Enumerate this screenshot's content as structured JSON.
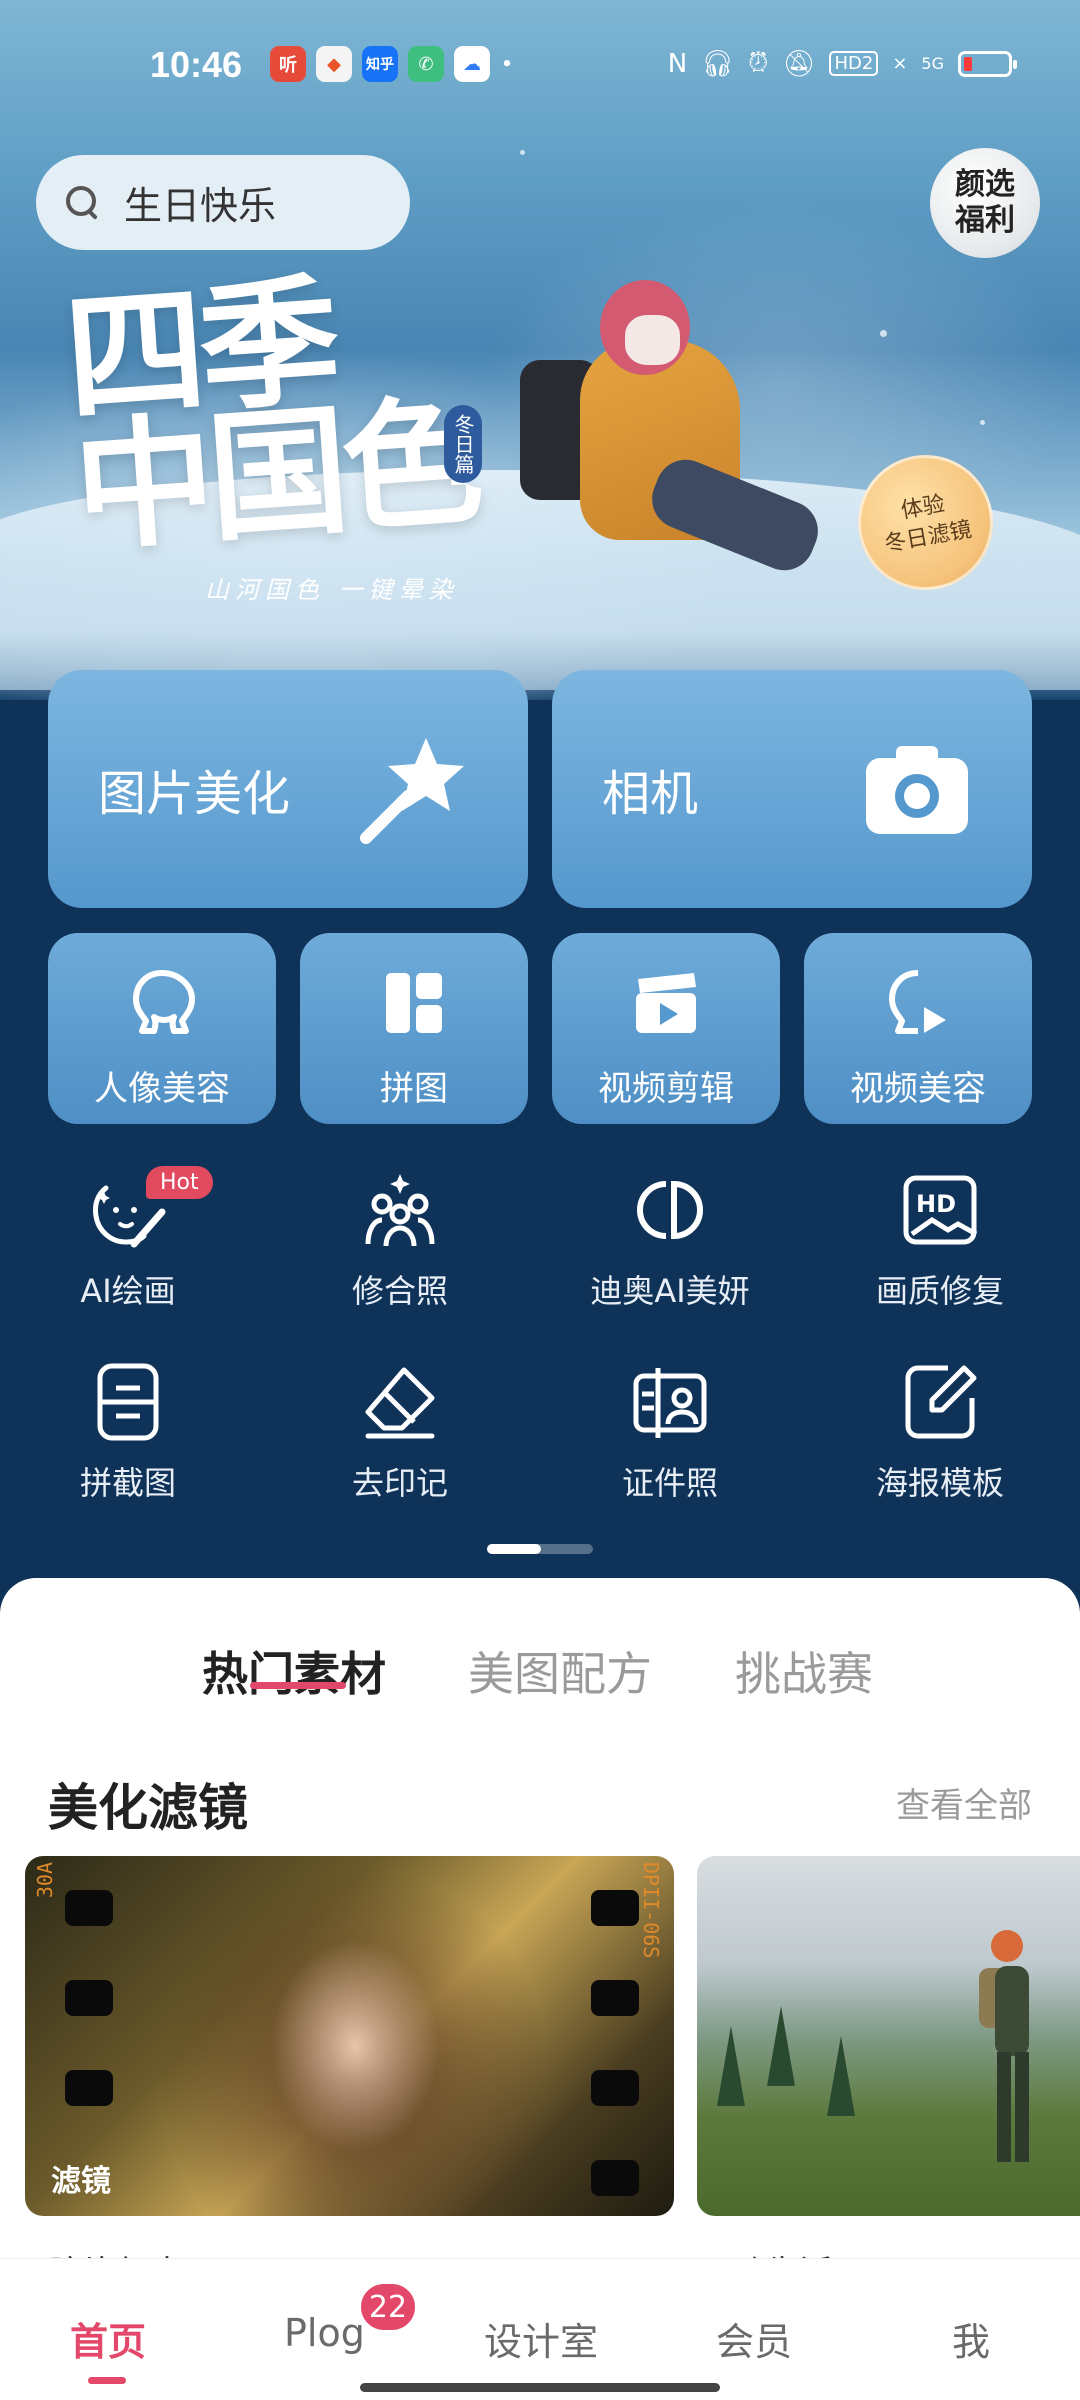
{
  "status_bar": {
    "time": "10:46",
    "app_icons": [
      {
        "name": "ting-app-icon",
        "text": "听",
        "color": "#e84a3a"
      },
      {
        "name": "game-app-icon",
        "text": "",
        "color": "#f0f0f0"
      },
      {
        "name": "zhihu-app-icon",
        "text": "知乎",
        "color": "#1772f6"
      },
      {
        "name": "phone-app-icon",
        "text": "",
        "color": "#3fbf7f"
      },
      {
        "name": "baidu-pan-app-icon",
        "text": "",
        "color": "#ffffff"
      }
    ],
    "network": "5G",
    "hd": "HD2"
  },
  "search": {
    "query": "生日快乐"
  },
  "promo_badge": {
    "label": "颜选\n福利"
  },
  "hero": {
    "title": "四季\n中国色",
    "season_tag": "冬日篇",
    "subtitle": "山河国色 一键晕染",
    "filter_badge": "体验\n冬日滤镜"
  },
  "big_tiles": [
    {
      "label": "图片美化",
      "icon": "magic-wand-icon"
    },
    {
      "label": "相机",
      "icon": "camera-icon"
    }
  ],
  "small_tiles": [
    {
      "label": "人像美容",
      "icon": "portrait-icon"
    },
    {
      "label": "拼图",
      "icon": "collage-icon"
    },
    {
      "label": "视频剪辑",
      "icon": "video-clap-icon"
    },
    {
      "label": "视频美容",
      "icon": "video-portrait-icon"
    }
  ],
  "tools": [
    {
      "label": "AI绘画",
      "icon": "ai-paint-icon",
      "badge": "Hot"
    },
    {
      "label": "修合照",
      "icon": "group-photo-icon"
    },
    {
      "label": "迪奥AI美妍",
      "icon": "dior-cd-icon"
    },
    {
      "label": "画质修复",
      "icon": "hd-repair-icon"
    },
    {
      "label": "拼截图",
      "icon": "screenshot-stitch-icon"
    },
    {
      "label": "去印记",
      "icon": "eraser-icon"
    },
    {
      "label": "证件照",
      "icon": "id-photo-icon"
    },
    {
      "label": "海报模板",
      "icon": "poster-edit-icon"
    }
  ],
  "content_tabs": [
    {
      "label": "热门素材",
      "active": true
    },
    {
      "label": "美图配方",
      "active": false
    },
    {
      "label": "挑战赛",
      "active": false
    }
  ],
  "section": {
    "title": "美化滤镜",
    "view_all": "查看全部"
  },
  "cards": [
    {
      "tag": "滤镜",
      "caption": "胶片复古",
      "edge_text": "30A",
      "edge_text2": "DPII-06S"
    },
    {
      "tag": "",
      "caption": "远动生活"
    }
  ],
  "bottom_nav": [
    {
      "label": "首页",
      "active": true
    },
    {
      "label": "Plog",
      "active": false,
      "badge": "22"
    },
    {
      "label": "设计室",
      "active": false
    },
    {
      "label": "会员",
      "active": false
    },
    {
      "label": "我",
      "active": false
    }
  ],
  "colors": {
    "accent": "#e3476a",
    "tile_blue": "#5598cd",
    "panel_bg": "#0f3358"
  }
}
